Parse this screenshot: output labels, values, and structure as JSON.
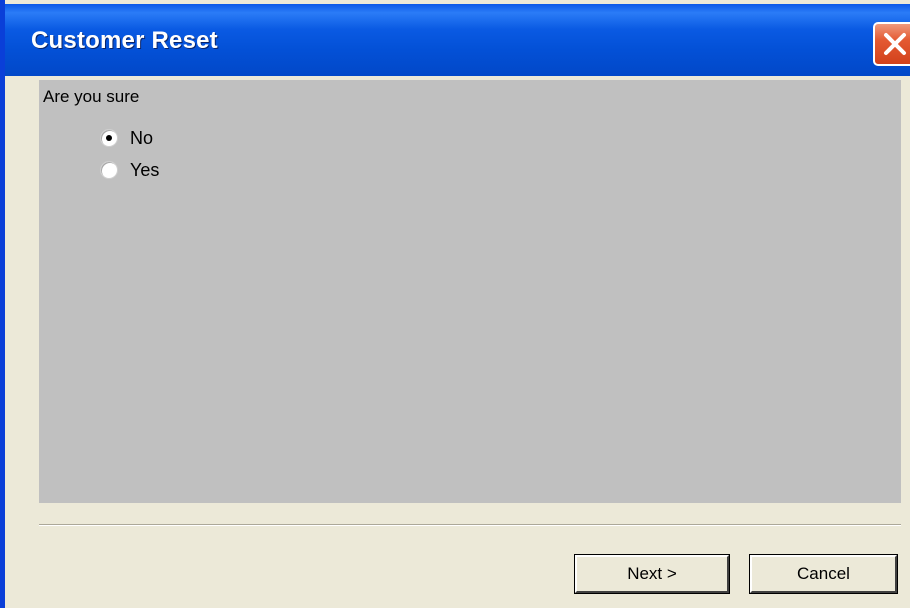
{
  "window": {
    "title": "Customer Reset",
    "close_icon": "close-icon",
    "colors": {
      "titlebar": "#0a58e8",
      "close_button": "#e45a32",
      "dialog_background": "#ece9d8",
      "content_background": "#c0c0c0"
    }
  },
  "form": {
    "prompt": "Are you sure",
    "options": [
      {
        "label": "No",
        "selected": true
      },
      {
        "label": "Yes",
        "selected": false
      }
    ]
  },
  "buttons": {
    "next_label": "Next >",
    "cancel_label": "Cancel"
  }
}
